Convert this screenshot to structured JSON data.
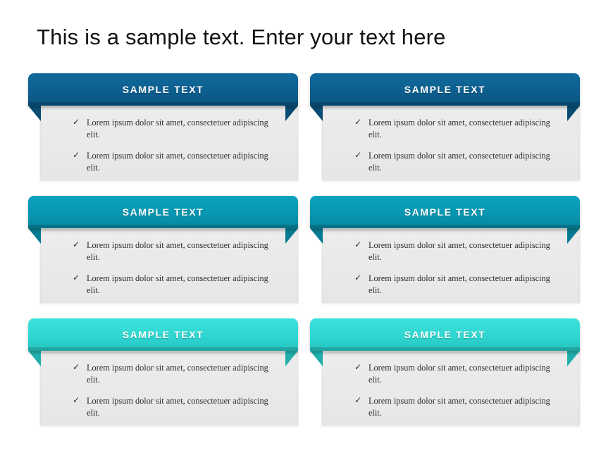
{
  "slide": {
    "title": "This is a sample text. Enter your text here",
    "background": "#ffffff"
  },
  "palette": {
    "row1_header": "#0B5E8E",
    "row1_header_dark": "#0A5480",
    "row1_tail": "#0A4C73",
    "row2_header": "#0795B0",
    "row2_header_dark": "#0686A0",
    "row2_tail": "#077C92",
    "row3_header": "#2FD5D0",
    "row3_header_dark": "#25C3BF",
    "row3_tail": "#21AFAB",
    "body_bg": "#EAEAEA",
    "body_text": "#2E2E2E",
    "header_text": "#FFFFFF",
    "title_text": "#121212"
  },
  "icons": {
    "bullet": "check-icon",
    "bullet_glyph": "✓"
  },
  "cards": [
    {
      "id": "card-1",
      "header": "SAMPLE TEXT",
      "bullets": [
        "Lorem ipsum dolor sit amet, consectetuer adipiscing elit.",
        "Lorem ipsum dolor sit amet, consectetuer adipiscing elit."
      ]
    },
    {
      "id": "card-2",
      "header": "SAMPLE TEXT",
      "bullets": [
        "Lorem ipsum dolor sit amet, consectetuer adipiscing elit.",
        "Lorem ipsum dolor sit amet, consectetuer adipiscing elit."
      ]
    },
    {
      "id": "card-3",
      "header": "SAMPLE TEXT",
      "bullets": [
        "Lorem ipsum dolor sit amet, consectetuer adipiscing elit.",
        "Lorem ipsum dolor sit amet, consectetuer adipiscing elit."
      ]
    },
    {
      "id": "card-4",
      "header": "SAMPLE TEXT",
      "bullets": [
        "Lorem ipsum dolor sit amet, consectetuer adipiscing elit.",
        "Lorem ipsum dolor sit amet, consectetuer adipiscing elit."
      ]
    },
    {
      "id": "card-5",
      "header": "SAMPLE TEXT",
      "bullets": [
        "Lorem ipsum dolor sit amet, consectetuer adipiscing elit.",
        "Lorem ipsum dolor sit amet, consectetuer adipiscing elit."
      ]
    },
    {
      "id": "card-6",
      "header": "SAMPLE TEXT",
      "bullets": [
        "Lorem ipsum dolor sit amet, consectetuer adipiscing elit.",
        "Lorem ipsum dolor sit amet, consectetuer adipiscing elit."
      ]
    }
  ]
}
